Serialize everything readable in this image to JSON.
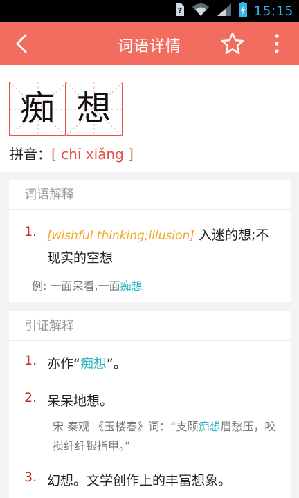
{
  "status_bar": {
    "time": "15:15",
    "icons": [
      "sim-unknown-icon",
      "wifi-icon",
      "signal-icon",
      "battery-charging-icon"
    ]
  },
  "app_bar": {
    "title": "词语详情",
    "back_icon": "back-chevron-icon",
    "favorite_icon": "star-outline-icon",
    "more_icon": "more-vertical-icon"
  },
  "headword": {
    "chars": [
      "痴",
      "想"
    ],
    "pinyin_label": "拼音：",
    "pinyin": "[ chī xiǎng ]"
  },
  "explanation": {
    "title": "词语解释",
    "items": [
      {
        "num": "1.",
        "english": "[wishful thinking;illusion]",
        "text": " 入迷的想;不现实的空想",
        "example_prefix": "例: 一面呆看,一面",
        "example_highlight": "痴想"
      }
    ]
  },
  "citations": {
    "title": "引证解释",
    "items": [
      {
        "num": "1.",
        "before": "亦作“",
        "highlight": "痴想",
        "after": "”。"
      },
      {
        "num": "2.",
        "text": "呆呆地想。",
        "cite_before": "宋 秦观 《玉楼春》词：“支颐",
        "cite_highlight": "痴想",
        "cite_after": "眉愁压，咬损纤纤银指甲。”"
      },
      {
        "num": "3.",
        "text": "幻想。文学创作上的丰富想象。"
      }
    ]
  },
  "colors": {
    "app_bar": "#f26c5f",
    "accent_red": "#e3534a",
    "number_red": "#c62828",
    "english_orange": "#f5a623",
    "highlight_teal": "#2ab4c0"
  }
}
